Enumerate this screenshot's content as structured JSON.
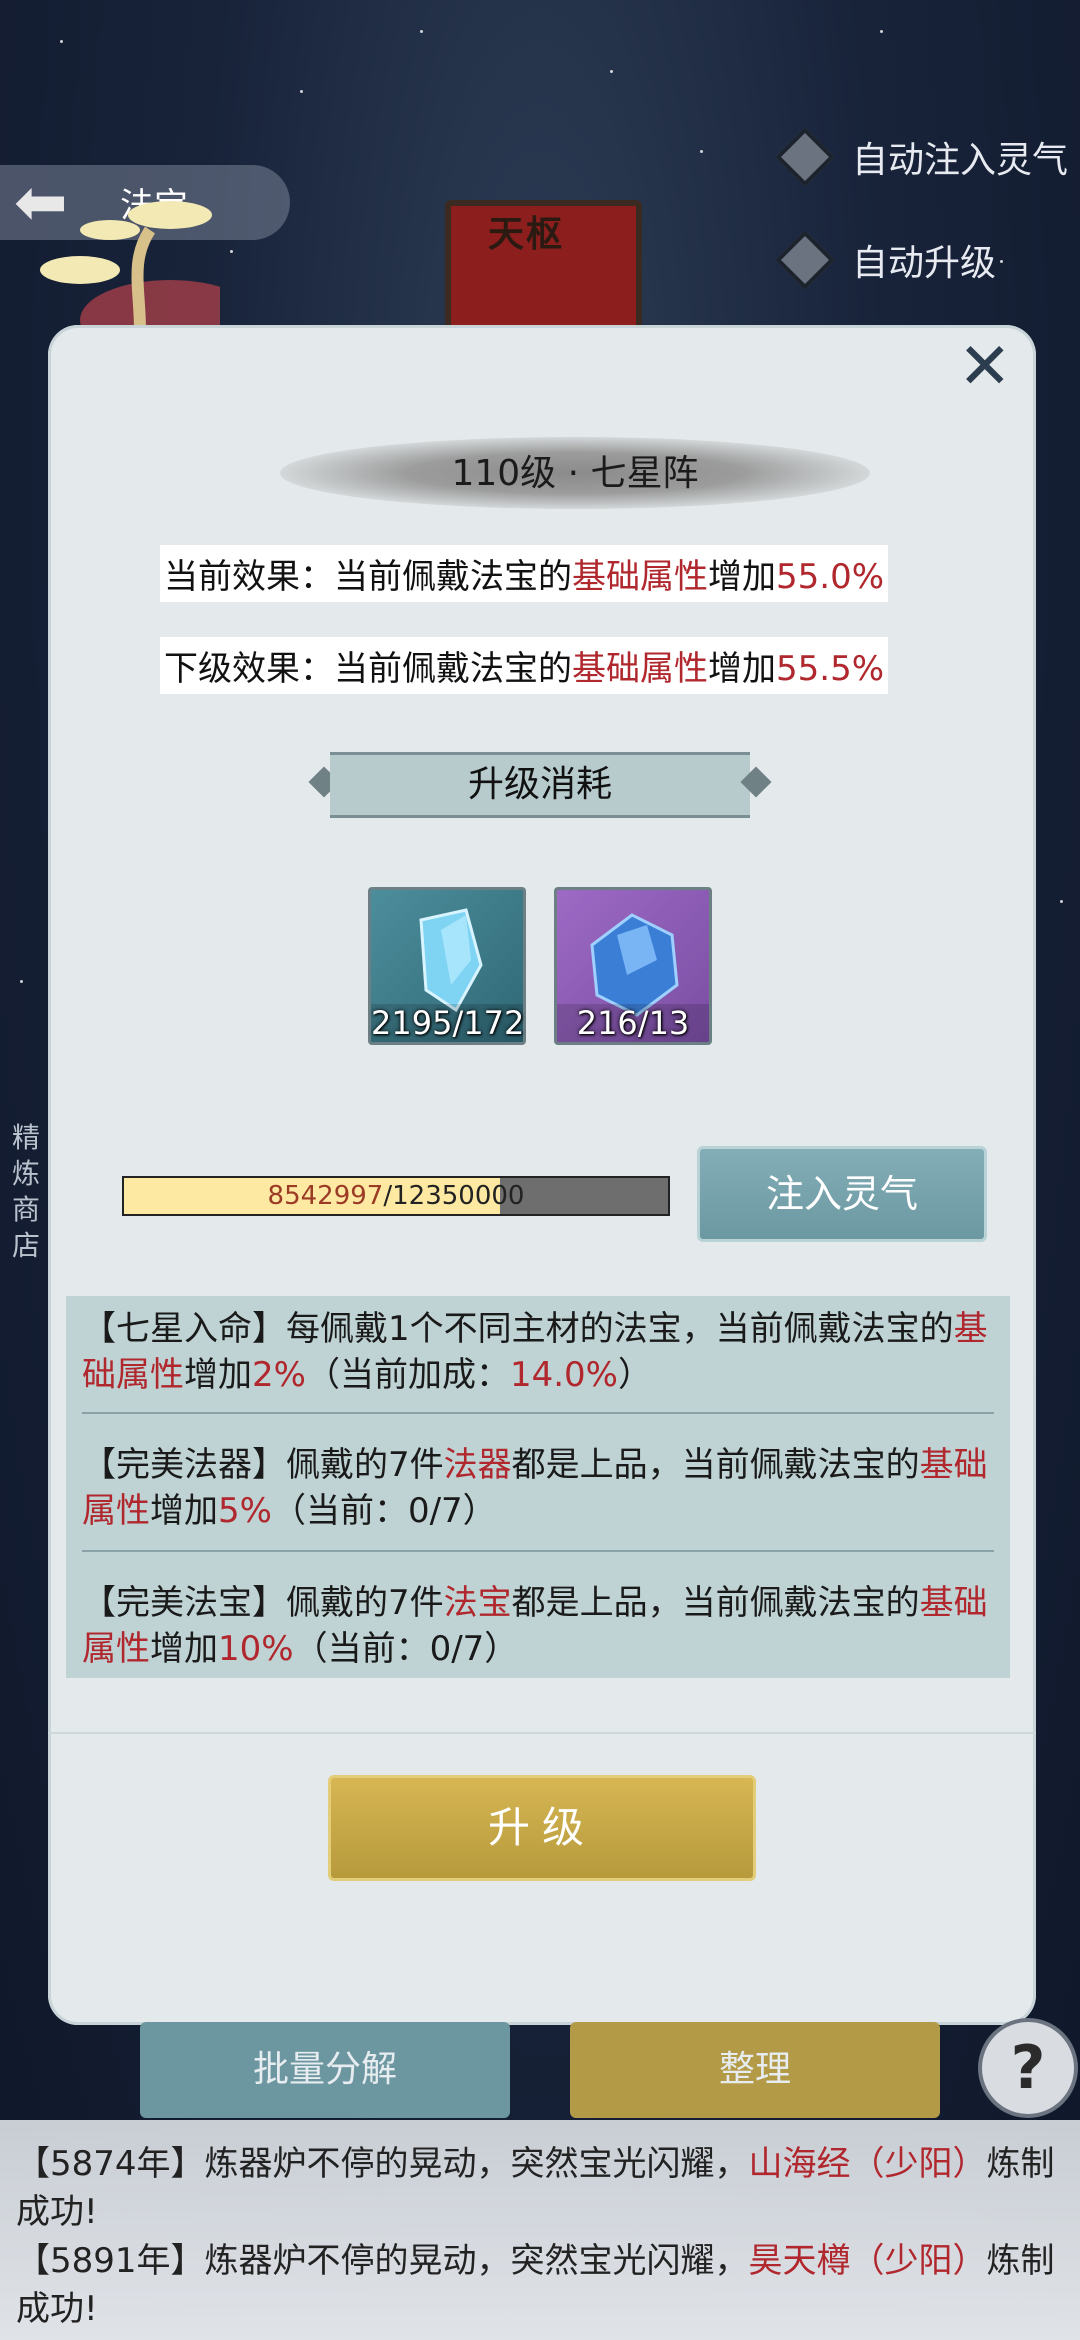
{
  "top_toggles": [
    {
      "label": "自动注入灵气"
    },
    {
      "label": "自动升级"
    }
  ],
  "header": {
    "back_title": "法宝",
    "badge_name": "天枢"
  },
  "modal": {
    "title": "110级 · 七星阵",
    "current_effect": {
      "prefix": "当前效果：当前佩戴法宝的",
      "highlight": "基础属性",
      "mid": "增加",
      "value": "55.0%"
    },
    "next_effect": {
      "prefix": "下级效果：当前佩戴法宝的",
      "highlight": "基础属性",
      "mid": "增加",
      "value": "55.5%"
    },
    "section_title": "升级消耗",
    "costs": [
      {
        "count": "2195/172",
        "icon": "blue-crystal-shard-icon"
      },
      {
        "count": "216/13",
        "icon": "blue-gem-icon"
      }
    ],
    "progress": {
      "text_current": "8542997",
      "text_sep": "/",
      "text_total": "12350000",
      "fraction": 0.6917
    },
    "inject_label": "注入灵气",
    "bonuses": [
      {
        "parts": [
          "【七星入命】每佩戴1个不同主材的法宝，当前佩戴法宝的",
          "基础属性",
          "增加",
          "2%",
          "（当前加成：",
          "14.0%",
          "）"
        ]
      },
      {
        "parts": [
          "【完美法器】佩戴的7件",
          "法器",
          "都是上品，当前佩戴法宝的",
          "基础属性",
          "增加",
          "5%",
          "（当前：0/7）"
        ]
      },
      {
        "parts": [
          "【完美法宝】佩戴的7件",
          "法宝",
          "都是上品，当前佩戴法宝的",
          "基础属性",
          "增加",
          "10%",
          "（当前：0/7）"
        ]
      }
    ],
    "upgrade_label": "升级"
  },
  "bottom": {
    "decompose_label": "批量分解",
    "sort_label": "整理",
    "help_label": "?",
    "side_text": "精炼商店"
  },
  "log": [
    {
      "prefix": "【5874年】炼器炉不停的晃动，突然宝光闪耀，",
      "item": "山海经（少阳）",
      "suffix": "炼制成功!"
    },
    {
      "prefix": "【5891年】炼器炉不停的晃动，突然宝光闪耀，",
      "item": "昊天樽（少阳）",
      "suffix": "炼制成功!"
    }
  ],
  "colors": {
    "accent_red": "#b0272d",
    "gold": "#c9a948",
    "teal": "#7aa6b0"
  }
}
